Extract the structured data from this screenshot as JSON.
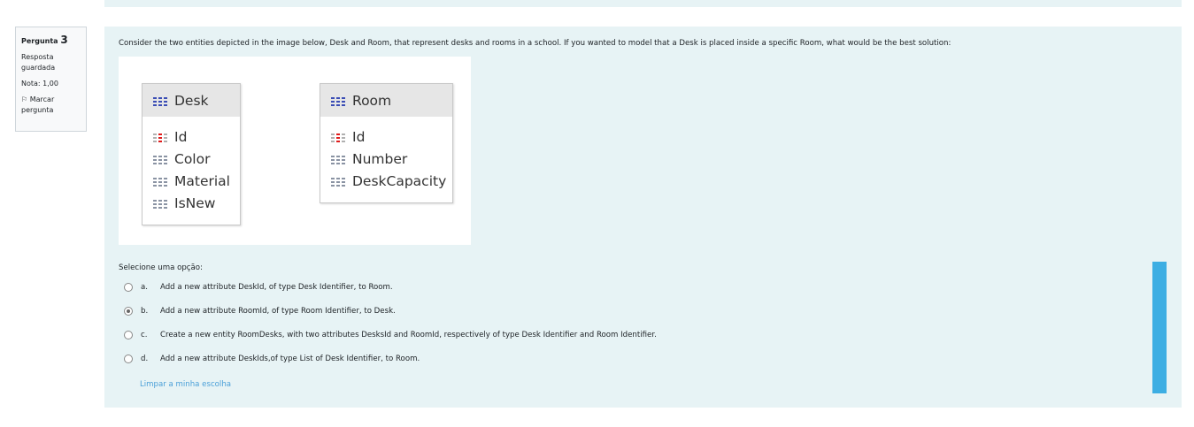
{
  "question_info": {
    "label": "Pergunta",
    "number": "3",
    "status": "Resposta guardada",
    "grade": "Nota: 1,00",
    "flag": "Marcar pergunta"
  },
  "question": {
    "text": "Consider the two entities depicted in the image below, Desk and Room, that represent desks and rooms in a school. If you wanted to model that a Desk is placed inside a specific Room, what would be the best solution:"
  },
  "diagram": {
    "entities": [
      {
        "name": "Desk",
        "attributes": [
          "Id",
          "Color",
          "Material",
          "IsNew"
        ]
      },
      {
        "name": "Room",
        "attributes": [
          "Id",
          "Number",
          "DeskCapacity"
        ]
      }
    ]
  },
  "answer": {
    "prompt": "Selecione uma opção:",
    "options": [
      {
        "letter": "a.",
        "text": "Add a new attribute DeskId, of type Desk Identifier, to Room.",
        "selected": false
      },
      {
        "letter": "b.",
        "text": "Add a new attribute RoomId, of type Room Identifier, to Desk.",
        "selected": true
      },
      {
        "letter": "c.",
        "text": "Create a new entity RoomDesks, with two attributes DesksId and RoomId, respectively of type Desk Identifier and Room Identifier.",
        "selected": false
      },
      {
        "letter": "d.",
        "text": "Add a new attribute DeskIds,of type List of Desk Identifier, to Room.",
        "selected": false
      }
    ],
    "clear": "Limpar a minha escolha"
  },
  "colors": {
    "accent": "#3daee3",
    "panel": "#e7f3f5",
    "link": "#4a9fd8"
  }
}
